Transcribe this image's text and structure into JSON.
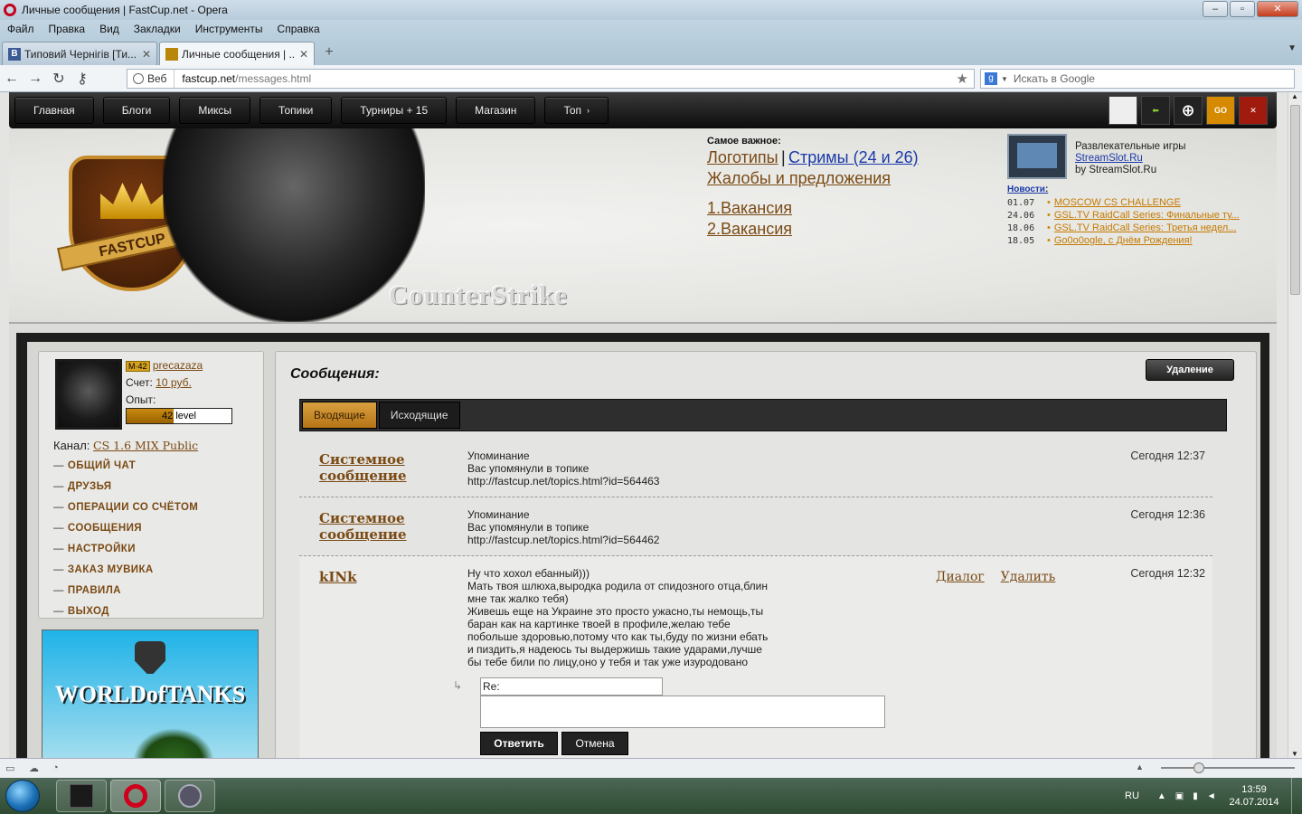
{
  "window": {
    "title": "Личные сообщения | FastCup.net - Opera"
  },
  "menu": [
    "Файл",
    "Правка",
    "Вид",
    "Закладки",
    "Инструменты",
    "Справка"
  ],
  "tabs": [
    {
      "icon": "В",
      "label": "Типовий Чернігів [Ти..."
    },
    {
      "icon": "",
      "label": "Личные сообщения | ..."
    }
  ],
  "address": {
    "badge": "Веб",
    "url_host": "fastcup.net",
    "url_path": "/messages.html",
    "search_placeholder": "Искать в Google"
  },
  "site_nav": [
    "Главная",
    "Блоги",
    "Миксы",
    "Топики",
    "Турниры + 15",
    "Магазин",
    "Топ"
  ],
  "game_icons": [
    "cs-icon",
    "arrow-icon",
    "crosshair-icon",
    "csgo-icon",
    "dota-icon"
  ],
  "game_icon_labels": [
    "",
    "",
    "",
    "GO",
    ""
  ],
  "banner": {
    "logo_text": "FASTCUP",
    "game_title": "CounterStrike",
    "important_heading": "Самое важное:",
    "links": {
      "logos": "Логотипы",
      "sep": "|",
      "streams": "Стримы (24 и 26)",
      "complaints": "Жалобы и предложения",
      "job1": "1.Вакансия",
      "job2": "2.Вакансия"
    }
  },
  "promo": {
    "line1": "Развлекательные игры",
    "link": "StreamSlot.Ru",
    "line3": "by StreamSlot.Ru"
  },
  "news": {
    "heading": "Новости",
    "colon": ":",
    "items": [
      {
        "date": "01.07",
        "title": "MOSCOW CS CHALLENGE"
      },
      {
        "date": "24.06",
        "title": "GSL.TV RaidCall Series: Финальные ту..."
      },
      {
        "date": "18.06",
        "title": "GSL.TV RaidCall Series: Третья недел..."
      },
      {
        "date": "18.05",
        "title": "Go0o0ogle, с Днём Рождения!"
      }
    ]
  },
  "profile": {
    "level_badge": "42",
    "username": "precazaza",
    "balance_label": "Счет:",
    "balance_value": "10 руб.",
    "xp_label": "Опыт:",
    "xp_text": "42 level",
    "xp_fraction": 0.45,
    "channel_label": "Канал:",
    "channel_value": "CS 1.6 MIX Public"
  },
  "left_menu": [
    "ОБЩИЙ ЧАТ",
    "ДРУЗЬЯ",
    "ОПЕРАЦИИ СО СЧЁТОМ",
    "СООБЩЕНИЯ",
    "НАСТРОЙКИ",
    "ЗАКАЗ МУВИКА",
    "ПРАВИЛА",
    "ВЫХОД"
  ],
  "ad": {
    "text": "WORLDofTANKS"
  },
  "messages_page": {
    "title": "Сообщения:",
    "delete_button": "Удаление",
    "tab_inbox": "Входящие",
    "tab_outbox": "Исходящие"
  },
  "messages": [
    {
      "from": "Системное сообщение",
      "subject": "Упоминание",
      "text": [
        "Вас упомянули в топике",
        "http://fastcup.net/topics.html?id=564463"
      ],
      "time": "Сегодня 12:37"
    },
    {
      "from": "Системное сообщение",
      "subject": "Упоминание",
      "text": [
        "Вас упомянули в топике",
        "http://fastcup.net/topics.html?id=564462"
      ],
      "time": "Сегодня 12:36"
    },
    {
      "from": "kINk",
      "subject": "",
      "text": [
        "Ну что хохол ебанный)))",
        "Мать твоя шлюха,выродка родила от спидозного отца,блин",
        "мне так жалко тебя)",
        "Живешь еще на Украине это просто ужасно,ты немощь,ты",
        "баран как на картинке твоей в профиле,желаю тебе",
        "побольше здоровью,потому что как ты,буду по жизни ебать",
        "и пиздить,я надеюсь ты выдержишь такие ударами,лучше",
        "бы тебе били по лицу,оно у тебя и так уже изуродовано"
      ],
      "time": "Сегодня 12:32",
      "action_dialog": "Диалог",
      "action_delete": "Удалить"
    }
  ],
  "reply": {
    "subject_value": "Re:",
    "send_button": "Ответить",
    "cancel_button": "Отмена"
  },
  "tray": {
    "lang": "RU",
    "time": "13:59",
    "date": "24.07.2014"
  }
}
